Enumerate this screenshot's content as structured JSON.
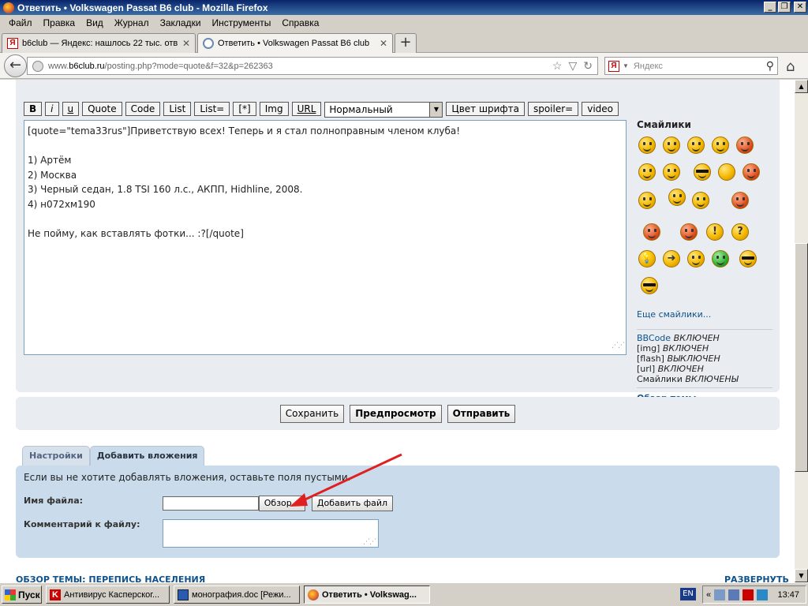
{
  "window": {
    "title": "Ответить • Volkswagen Passat B6 club - Mozilla Firefox",
    "controls": [
      "_",
      "❐",
      "✕"
    ]
  },
  "menu": [
    "Файл",
    "Правка",
    "Вид",
    "Журнал",
    "Закладки",
    "Инструменты",
    "Справка"
  ],
  "tabs": [
    {
      "label": "b6club — Яндекс: нашлось 22 тыс. отв...",
      "close": "✕"
    },
    {
      "label": "Ответить • Volkswagen Passat B6 club",
      "close": "✕"
    }
  ],
  "new_tab": "+",
  "nav": {
    "back": "←",
    "url_prefix": "www.",
    "url_host": "b6club.ru",
    "url_rest": "/posting.php?mode=quote&f=32&p=262363",
    "bookmark_star": "☆",
    "dropdown": "▽",
    "reload": "↻",
    "search_engine_icon": "Я",
    "search_dropdown": "▼",
    "search_placeholder": "Яндекс",
    "search_icon": "⚲",
    "home_icon": "⌂"
  },
  "bbcode_buttons": {
    "bold": "B",
    "italic": "i",
    "underline": "u",
    "quote": "Quote",
    "code": "Code",
    "list": "List",
    "list_eq": "List=",
    "list_item": "[*]",
    "img": "Img",
    "url": "URL",
    "font_size": "Нормальный",
    "font_color": "Цвет шрифта",
    "spoiler": "spoiler=",
    "video": "video"
  },
  "message_lines": [
    "[quote=\"tema33rus\"]Приветствую всех! Теперь и я стал полноправным членом клуба!",
    "",
    "1) Артём",
    "2) Москва",
    "3) Черный седан, 1.8 TSI 160 л.с., АКПП, Hidhline, 2008.",
    "4) н072хм190",
    "",
    "Не пойму, как вставлять фотки... :?[/quote]"
  ],
  "resize_grip": "⋰⋰",
  "smilies": {
    "title": "Смайлики",
    "items": [
      "grin",
      "smile",
      "happy",
      "sad",
      "shout",
      "surprised",
      "neutral",
      "cool",
      "blank",
      "mad",
      "lol",
      "wink",
      "cry",
      "twisted",
      "evil",
      "think",
      "exclaim",
      "question",
      "idea",
      "arrow",
      "razz",
      "green",
      "shades",
      "cool2"
    ],
    "more": "Еще смайлики..."
  },
  "bb_status": [
    {
      "name": "BBCode",
      "state": "ВКЛЮЧЕН"
    },
    {
      "name": "[img]",
      "state": "ВКЛЮЧЕН"
    },
    {
      "name": "[flash]",
      "state": "ВЫКЛЮЧЕН"
    },
    {
      "name": "[url]",
      "state": "ВКЛЮЧЕН"
    },
    {
      "name": "Смайлики",
      "state": "ВКЛЮЧЕНЫ"
    }
  ],
  "topic_review_link": "Обзор темы",
  "submit": {
    "save": "Сохранить",
    "preview": "Предпросмотр",
    "send": "Отправить"
  },
  "attach_tabs": [
    "Настройки",
    "Добавить вложения"
  ],
  "attach": {
    "hint": "Если вы не хотите добавлять вложения, оставьте поля пустыми.",
    "filename_label": "Имя файла:",
    "browse": "Обзор...",
    "add_file": "Добавить файл",
    "comment_label": "Комментарий к файлу:"
  },
  "footer": {
    "left": "ОБЗОР ТЕМЫ: ПЕРЕПИСЬ НАСЕЛЕНИЯ",
    "right": "РАЗВЕРНУТЬ"
  },
  "colors": {
    "annotation_arrow": "#e02020",
    "link": "#105289",
    "panel": "#cadceb",
    "postbox": "#e9edf1"
  },
  "scroll_arrows": {
    "up": "▲",
    "down": "▼"
  },
  "taskbar": {
    "start": "Пуск",
    "items": [
      {
        "label": "Антивирус Касперског..."
      },
      {
        "label": "монография.doc [Режи..."
      },
      {
        "label": "Ответить • Volkswag..."
      }
    ],
    "lang": "EN",
    "tray_chevron": "«",
    "clock": "13:47"
  }
}
